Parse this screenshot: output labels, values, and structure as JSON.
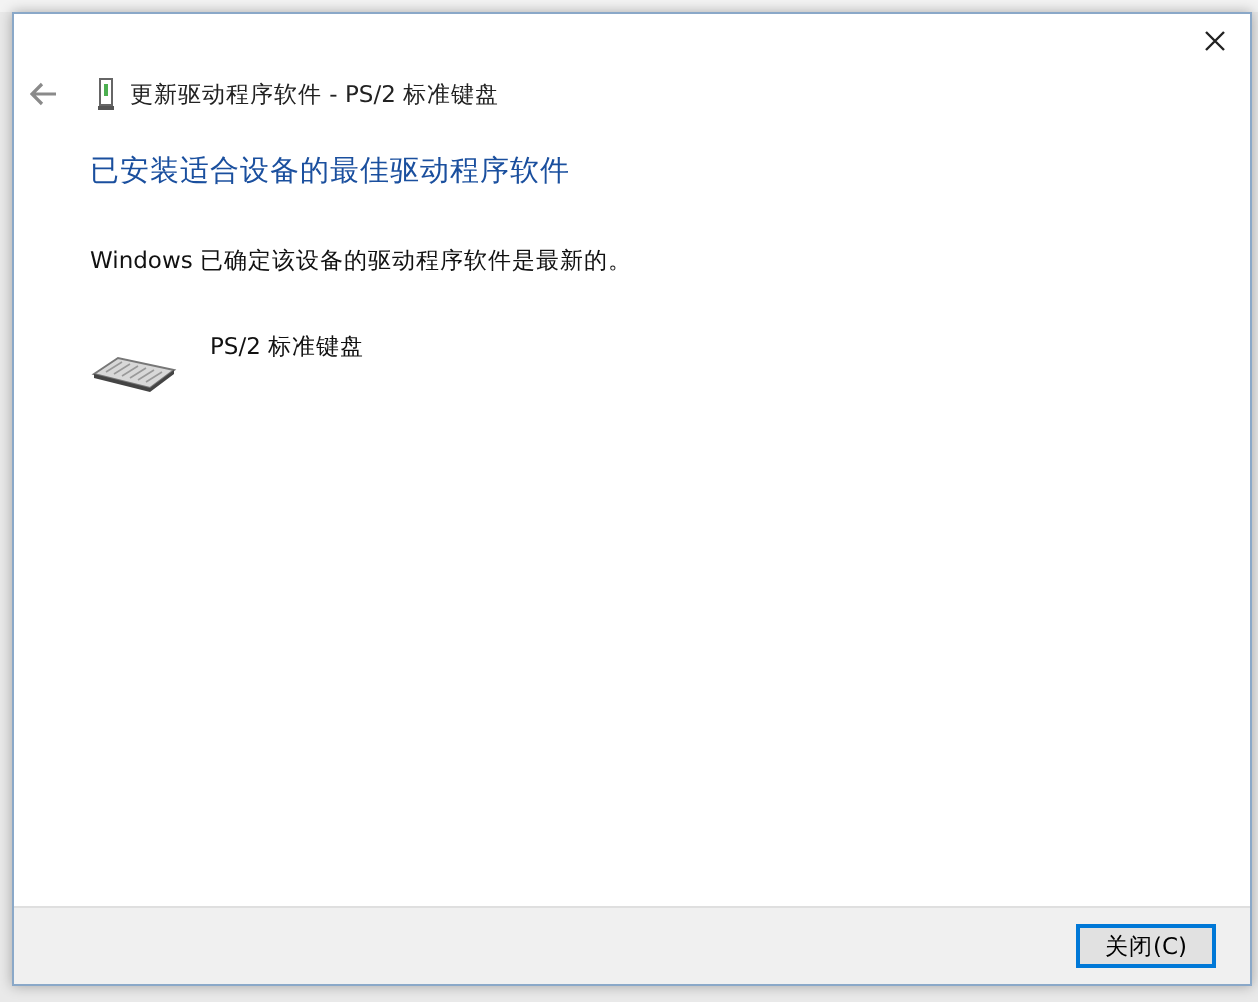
{
  "window": {
    "title": "更新驱动程序软件 - PS/2 标准键盘"
  },
  "heading": "已安装适合设备的最佳驱动程序软件",
  "message": "Windows 已确定该设备的驱动程序软件是最新的。",
  "device": {
    "name": "PS/2 标准键盘"
  },
  "buttons": [
    {
      "label": "关闭(C)",
      "default": true
    }
  ]
}
